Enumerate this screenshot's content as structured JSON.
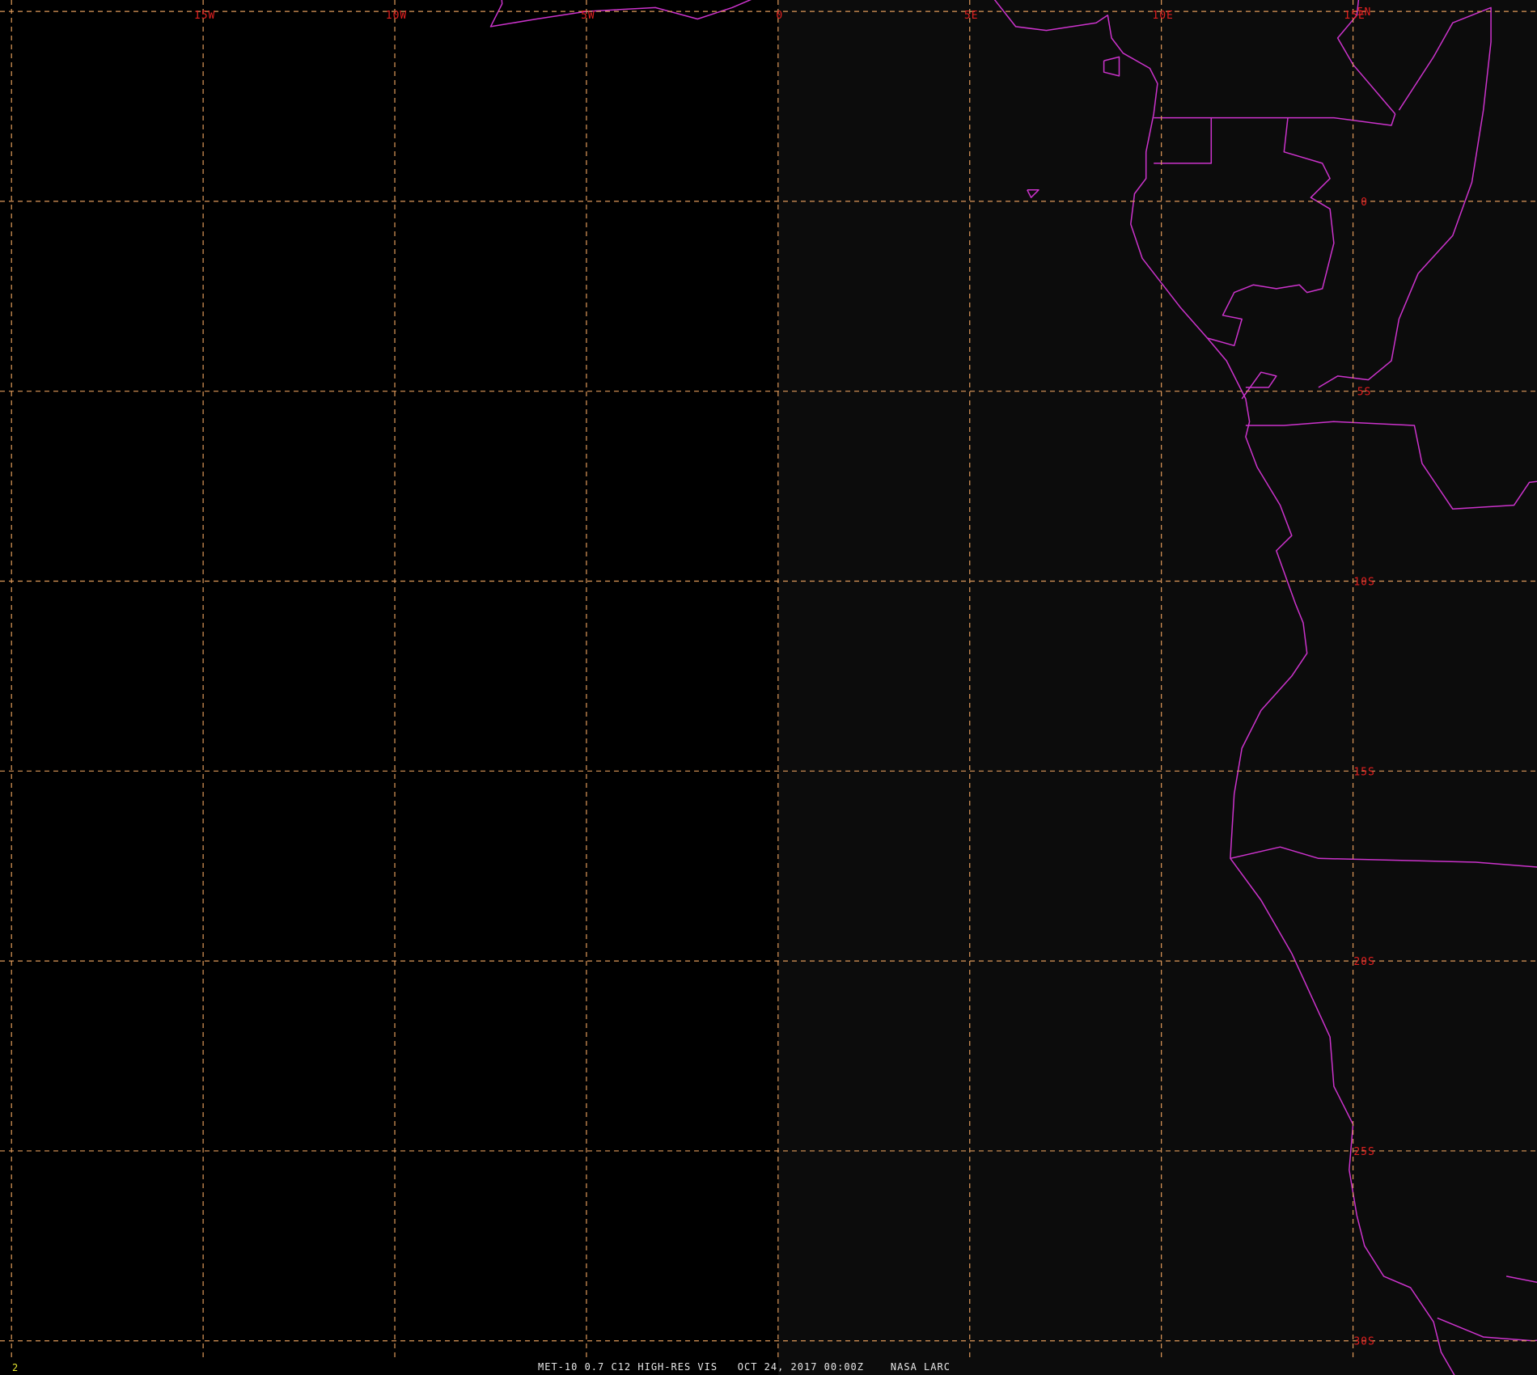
{
  "frame_number": "2",
  "caption": "MET-10 0.7 C12 HIGH-RES VIS   OCT 24, 2017 00:00Z    NASA LARC",
  "colors": {
    "background": "#000000",
    "land_tint": "#0c0c0c",
    "grid": "#e09a5a",
    "grid_label": "#e02020",
    "coastline": "#cc33cc",
    "caption": "#e8e8e8",
    "frame_number": "#e8e830"
  },
  "grid": {
    "longitudes": [
      {
        "deg": -20,
        "label": ""
      },
      {
        "deg": -15,
        "label": "15W"
      },
      {
        "deg": -10,
        "label": "10W"
      },
      {
        "deg": -5,
        "label": "5W"
      },
      {
        "deg": 0,
        "label": "0"
      },
      {
        "deg": 5,
        "label": "5E"
      },
      {
        "deg": 10,
        "label": "10E"
      },
      {
        "deg": 15,
        "label": "15E"
      }
    ],
    "latitudes": [
      {
        "deg": 5,
        "label": "5N"
      },
      {
        "deg": 0,
        "label": "0"
      },
      {
        "deg": -5,
        "label": "5S"
      },
      {
        "deg": -10,
        "label": "10S"
      },
      {
        "deg": -15,
        "label": "15S"
      },
      {
        "deg": -20,
        "label": "20S"
      },
      {
        "deg": -25,
        "label": "25S"
      },
      {
        "deg": -30,
        "label": "30S"
      }
    ]
  },
  "map_features": {
    "coastlines": [
      {
        "name": "west-africa-coast",
        "points": [
          [
            -7.3,
            6.3
          ],
          [
            -7.2,
            5.2
          ],
          [
            -7.5,
            4.6
          ],
          [
            -6.3,
            4.8
          ],
          [
            -5,
            5.0
          ],
          [
            -3.2,
            5.1
          ],
          [
            -2.1,
            4.8
          ],
          [
            -1.2,
            5.1
          ],
          [
            -0.5,
            5.4
          ],
          [
            1.0,
            5.9
          ]
        ]
      },
      {
        "name": "central-africa-coast",
        "points": [
          [
            5.3,
            6.2
          ],
          [
            5.5,
            5.5
          ],
          [
            6.2,
            4.6
          ],
          [
            7.0,
            4.5
          ],
          [
            8.3,
            4.7
          ],
          [
            8.6,
            4.9
          ],
          [
            8.7,
            4.3
          ],
          [
            9.0,
            3.9
          ],
          [
            9.7,
            3.5
          ],
          [
            9.9,
            3.1
          ],
          [
            9.8,
            2.3
          ],
          [
            9.6,
            1.3
          ],
          [
            9.6,
            0.6
          ],
          [
            9.3,
            0.2
          ],
          [
            9.2,
            -0.6
          ],
          [
            9.5,
            -1.5
          ],
          [
            10.5,
            -2.8
          ],
          [
            11.2,
            -3.6
          ],
          [
            11.7,
            -4.2
          ],
          [
            12.2,
            -5.2
          ],
          [
            12.3,
            -5.8
          ],
          [
            12.2,
            -6.2
          ],
          [
            12.5,
            -7.0
          ],
          [
            13.1,
            -8.0
          ],
          [
            13.4,
            -8.8
          ],
          [
            13.0,
            -9.2
          ],
          [
            13.5,
            -10.6
          ],
          [
            13.7,
            -11.1
          ],
          [
            13.8,
            -11.9
          ],
          [
            13.4,
            -12.5
          ],
          [
            12.6,
            -13.4
          ],
          [
            12.1,
            -14.4
          ],
          [
            11.9,
            -15.6
          ],
          [
            11.8,
            -17.3
          ],
          [
            12.6,
            -18.4
          ],
          [
            13.4,
            -19.8
          ],
          [
            14.4,
            -22.0
          ],
          [
            14.5,
            -23.3
          ],
          [
            15.0,
            -24.3
          ],
          [
            14.9,
            -25.5
          ],
          [
            15.1,
            -26.7
          ],
          [
            15.3,
            -27.5
          ],
          [
            15.8,
            -28.3
          ],
          [
            16.5,
            -28.6
          ],
          [
            17.1,
            -29.5
          ],
          [
            17.3,
            -30.3
          ],
          [
            17.7,
            -31.0
          ],
          [
            18.1,
            -31.6
          ]
        ]
      },
      {
        "name": "south-africa-coast",
        "points": [
          [
            17.2,
            -29.4
          ],
          [
            18.4,
            -29.9
          ],
          [
            19.7,
            -30.0
          ],
          [
            20.6,
            -29.9
          ],
          [
            21.3,
            -29.7
          ],
          [
            21.6,
            -29.6
          ]
        ]
      },
      {
        "name": "bioko-island",
        "points": [
          [
            8.5,
            3.7
          ],
          [
            8.9,
            3.8
          ],
          [
            8.9,
            3.3
          ],
          [
            8.5,
            3.4
          ],
          [
            8.5,
            3.7
          ]
        ]
      },
      {
        "name": "sao-tome-island",
        "points": [
          [
            6.5,
            0.3
          ],
          [
            6.8,
            0.3
          ],
          [
            6.6,
            0.1
          ],
          [
            6.5,
            0.3
          ]
        ]
      }
    ],
    "borders": [
      {
        "name": "cameroon-eq-guinea",
        "points": [
          [
            9.8,
            2.2
          ],
          [
            11.3,
            2.2
          ],
          [
            11.3,
            1.0
          ],
          [
            9.8,
            1.0
          ]
        ]
      },
      {
        "name": "cameroon-gabon-congo",
        "points": [
          [
            11.3,
            2.2
          ],
          [
            13.3,
            2.2
          ],
          [
            14.5,
            2.2
          ],
          [
            16.0,
            2.0
          ],
          [
            16.1,
            2.3
          ]
        ]
      },
      {
        "name": "car-cameroon",
        "points": [
          [
            15.2,
            5.8
          ],
          [
            15.1,
            4.9
          ],
          [
            14.6,
            4.3
          ],
          [
            15.0,
            3.6
          ],
          [
            16.1,
            2.3
          ]
        ]
      },
      {
        "name": "drc-congo",
        "points": [
          [
            16.2,
            2.4
          ],
          [
            17.1,
            3.8
          ],
          [
            17.6,
            4.7
          ],
          [
            18.6,
            5.1
          ],
          [
            18.6,
            4.2
          ],
          [
            18.4,
            2.4
          ],
          [
            18.1,
            0.5
          ],
          [
            17.6,
            -0.9
          ],
          [
            16.7,
            -1.9
          ],
          [
            16.2,
            -3.1
          ],
          [
            16.0,
            -4.2
          ],
          [
            15.4,
            -4.7
          ],
          [
            14.6,
            -4.6
          ],
          [
            14.1,
            -4.9
          ]
        ]
      },
      {
        "name": "gabon-congo",
        "points": [
          [
            13.3,
            2.2
          ],
          [
            13.2,
            1.3
          ],
          [
            14.2,
            1.0
          ],
          [
            14.4,
            0.6
          ],
          [
            13.9,
            0.1
          ],
          [
            14.4,
            -0.2
          ],
          [
            14.5,
            -1.1
          ],
          [
            14.2,
            -2.3
          ],
          [
            13.8,
            -2.4
          ],
          [
            13.6,
            -2.2
          ],
          [
            13.0,
            -2.3
          ],
          [
            12.4,
            -2.2
          ],
          [
            11.9,
            -2.4
          ],
          [
            11.6,
            -3.0
          ],
          [
            12.1,
            -3.1
          ],
          [
            11.9,
            -3.8
          ],
          [
            11.2,
            -3.6
          ]
        ]
      },
      {
        "name": "cabinda",
        "points": [
          [
            12.2,
            -4.9
          ],
          [
            12.8,
            -4.9
          ],
          [
            13.0,
            -4.6
          ],
          [
            12.6,
            -4.5
          ],
          [
            12.1,
            -5.2
          ]
        ]
      },
      {
        "name": "angola-drc",
        "points": [
          [
            12.2,
            -5.9
          ],
          [
            13.2,
            -5.9
          ],
          [
            14.5,
            -5.8
          ],
          [
            16.6,
            -5.9
          ],
          [
            16.8,
            -6.9
          ],
          [
            17.6,
            -8.1
          ],
          [
            19.2,
            -8.0
          ],
          [
            19.6,
            -7.4
          ],
          [
            21.2,
            -7.2
          ],
          [
            21.8,
            -7.2
          ]
        ]
      },
      {
        "name": "angola-namibia",
        "points": [
          [
            11.8,
            -17.3
          ],
          [
            13.1,
            -17.0
          ],
          [
            14.1,
            -17.3
          ],
          [
            18.2,
            -17.4
          ],
          [
            20.7,
            -17.6
          ],
          [
            21.4,
            -17.9
          ],
          [
            23.4,
            -18.0
          ]
        ]
      },
      {
        "name": "namibia-botswana",
        "points": [
          [
            20.0,
            -22.0
          ],
          [
            21.0,
            -22.0
          ],
          [
            20.9,
            -24.8
          ],
          [
            20.9,
            -26.6
          ]
        ]
      },
      {
        "name": "orange-river",
        "points": [
          [
            19.0,
            -28.3
          ],
          [
            20.0,
            -28.5
          ]
        ]
      }
    ]
  },
  "extent": {
    "lon_min": -20.3,
    "lon_max": 19.8,
    "lat_min": -30.9,
    "lat_max": 5.3
  }
}
